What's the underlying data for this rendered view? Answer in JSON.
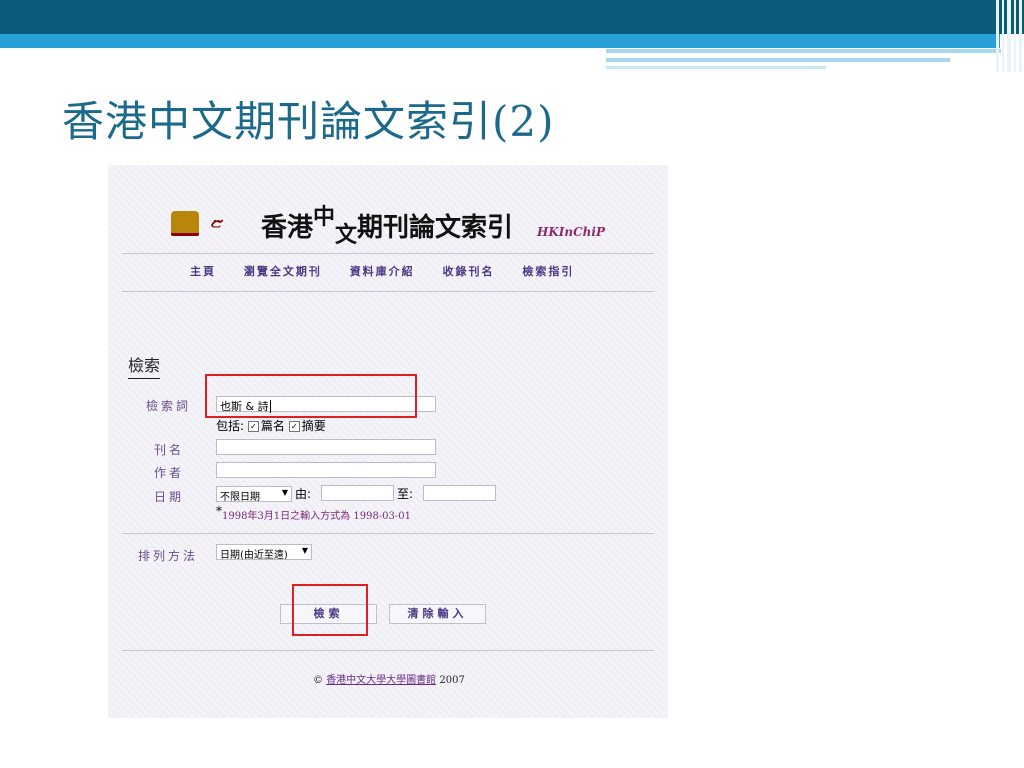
{
  "slide_title": "香港中文期刊論文索引(2)",
  "logo": {
    "title_part1": "香港",
    "title_raised": "中",
    "title_dropped": "文",
    "title_part2": "期刊論文索引",
    "english": "HKInChiP"
  },
  "nav": [
    "主頁",
    "瀏覽全文期刊",
    "資料庫介紹",
    "收錄刊名",
    "檢索指引"
  ],
  "search": {
    "section_title": "檢索",
    "keyword_label": "檢索詞",
    "keyword_value": "也斯 & 詩",
    "include_label": "包括:",
    "include_options": [
      "篇名",
      "摘要"
    ],
    "journal_label": "刊名",
    "author_label": "作者",
    "date_label": "日期",
    "date_select": "不限日期",
    "from_label": "由:",
    "to_label": "至:",
    "date_note": "1998年3月1日之輸入方式為 1998-03-01",
    "sort_label": "排列方法",
    "sort_select": "日期(由近至遠)",
    "search_button": "檢索",
    "clear_button": "清除輸入"
  },
  "footer": {
    "copyright": "©",
    "link": "香港中文大學大學圖書館",
    "year": "2007"
  },
  "colors": {
    "header_dark": "#0d5b7a",
    "header_light": "#2a9fd6",
    "title": "#1b6a8c",
    "highlight": "#e02020",
    "nav": "#4a3a86"
  }
}
